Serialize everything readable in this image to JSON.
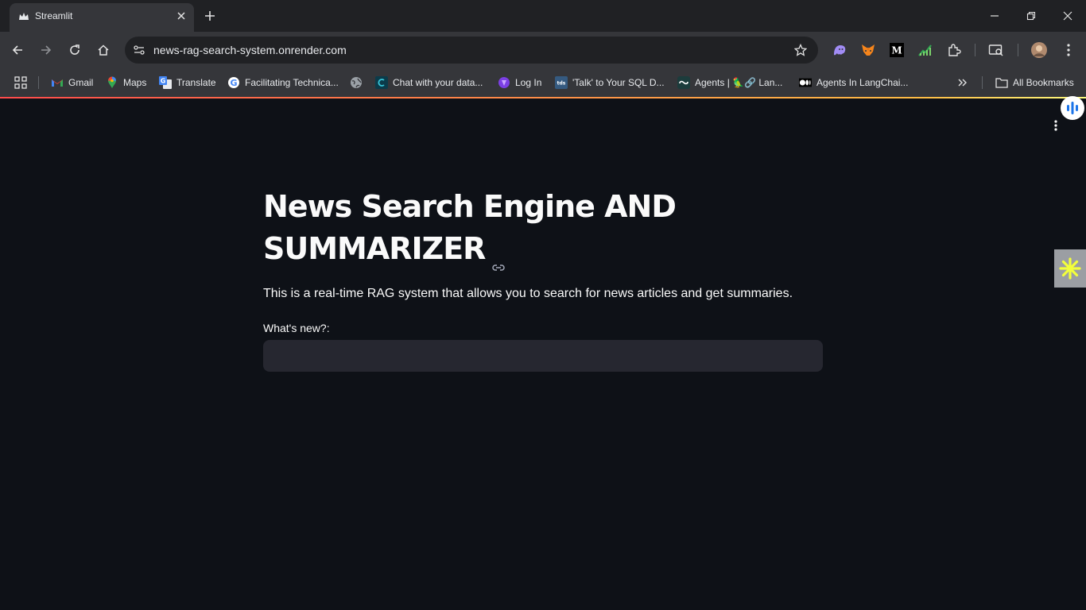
{
  "browser": {
    "tab": {
      "title": "Streamlit"
    },
    "url": "news-rag-search-system.onrender.com",
    "bookmarks": [
      {
        "label": "Gmail"
      },
      {
        "label": "Maps"
      },
      {
        "label": "Translate"
      },
      {
        "label": "Facilitating Technica..."
      },
      {
        "label": ""
      },
      {
        "label": "Chat with your data..."
      },
      {
        "label": "Log In"
      },
      {
        "label": "'Talk' to Your SQL D..."
      },
      {
        "label": "Agents | 🦜🔗 Lan..."
      },
      {
        "label": "Agents In LangChai..."
      }
    ],
    "all_bookmarks": "All Bookmarks"
  },
  "app": {
    "title_line1": "News Search Engine AND",
    "title_line2": "SUMMARIZER",
    "description": "This is a real-time RAG system that allows you to search for news articles and get summaries.",
    "input_label": "What's new?:",
    "input_value": ""
  },
  "colors": {
    "background": "#0e1117",
    "input_bg": "#262730",
    "text": "#fafafa",
    "chrome_dark": "#202124",
    "chrome_toolbar": "#35363a"
  }
}
